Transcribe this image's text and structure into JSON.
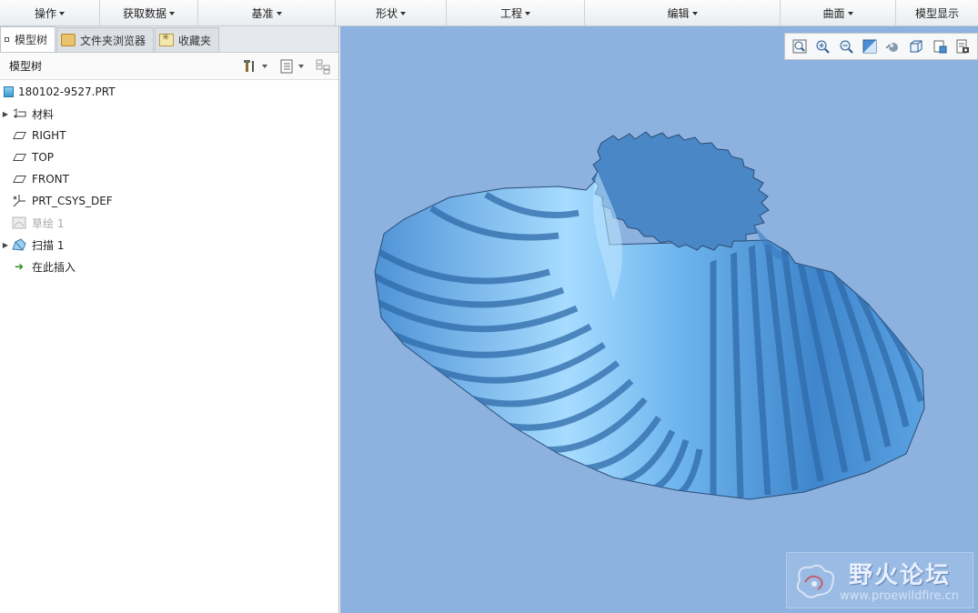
{
  "menubar": {
    "items": [
      {
        "label": "操作",
        "has_caret": true
      },
      {
        "label": "获取数据",
        "has_caret": true
      },
      {
        "label": "基准",
        "has_caret": true
      },
      {
        "label": "形状",
        "has_caret": true
      },
      {
        "label": "工程",
        "has_caret": true
      },
      {
        "label": "编辑",
        "has_caret": true
      },
      {
        "label": "曲面",
        "has_caret": true
      },
      {
        "label": "模型显示",
        "has_caret": false
      }
    ]
  },
  "left_panel": {
    "tabs": [
      {
        "label": "模型树",
        "icon": "model-tree-icon",
        "active": true
      },
      {
        "label": "文件夹浏览器",
        "icon": "folder-icon",
        "active": false
      },
      {
        "label": "收藏夹",
        "icon": "favorites-icon",
        "active": false
      }
    ],
    "tree_header": {
      "title": "模型树",
      "tools": [
        "settings-tools-icon",
        "show-options-icon",
        "filter-icon"
      ]
    },
    "tree": [
      {
        "label": "180102-9527.PRT",
        "icon": "part-icon",
        "expander": false,
        "dim": false,
        "level": 0
      },
      {
        "label": "材料",
        "icon": "material-icon",
        "expander": true,
        "dim": false,
        "level": 1
      },
      {
        "label": "RIGHT",
        "icon": "datum-plane-icon",
        "expander": false,
        "dim": false,
        "level": 1
      },
      {
        "label": "TOP",
        "icon": "datum-plane-icon",
        "expander": false,
        "dim": false,
        "level": 1
      },
      {
        "label": "FRONT",
        "icon": "datum-plane-icon",
        "expander": false,
        "dim": false,
        "level": 1
      },
      {
        "label": "PRT_CSYS_DEF",
        "icon": "csys-icon",
        "expander": false,
        "dim": false,
        "level": 1
      },
      {
        "label": "草绘 1",
        "icon": "sketch-icon",
        "expander": false,
        "dim": true,
        "level": 1
      },
      {
        "label": "扫描 1",
        "icon": "sweep-icon",
        "expander": true,
        "dim": false,
        "level": 1
      },
      {
        "label": "在此插入",
        "icon": "insert-here-icon",
        "expander": false,
        "dim": false,
        "level": 1
      }
    ]
  },
  "viewport": {
    "background_color": "#8db2e0",
    "model_color": "#5ea8ea",
    "view_toolbar": [
      "refit-icon",
      "zoom-in-icon",
      "zoom-out-icon",
      "repaint-icon",
      "display-style-icon",
      "saved-views-icon",
      "view-manager-icon",
      "render-icon"
    ],
    "watermark": {
      "title": "野火论坛",
      "url": "www.proewildfire.cn"
    }
  }
}
